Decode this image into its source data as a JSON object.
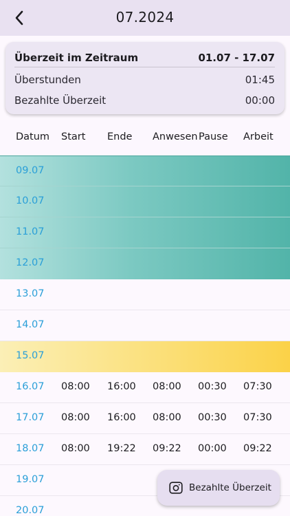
{
  "header": {
    "title": "07.2024",
    "back_icon": "back-arrow-icon"
  },
  "summary": {
    "title": "Überzeit im Zeitraum",
    "range": "01.07 - 17.07",
    "ueberstunden_label": "Überstunden",
    "ueberstunden_value": "01:45",
    "bezahlt_label": "Bezahlte Überzeit",
    "bezahlt_value": "00:00"
  },
  "table": {
    "columns": [
      "Datum",
      "Start",
      "Ende",
      "Anwesen",
      "Pause",
      "Arbeit"
    ],
    "rows": [
      {
        "date": "09.07",
        "start": "",
        "ende": "",
        "anwesend": "",
        "pause": "",
        "arbeit": ""
      },
      {
        "date": "10.07",
        "start": "",
        "ende": "",
        "anwesend": "",
        "pause": "",
        "arbeit": ""
      },
      {
        "date": "11.07",
        "start": "",
        "ende": "",
        "anwesend": "",
        "pause": "",
        "arbeit": ""
      },
      {
        "date": "12.07",
        "start": "",
        "ende": "",
        "anwesend": "",
        "pause": "",
        "arbeit": ""
      },
      {
        "date": "13.07",
        "start": "",
        "ende": "",
        "anwesend": "",
        "pause": "",
        "arbeit": ""
      },
      {
        "date": "14.07",
        "start": "",
        "ende": "",
        "anwesend": "",
        "pause": "",
        "arbeit": ""
      },
      {
        "date": "15.07",
        "start": "",
        "ende": "",
        "anwesend": "",
        "pause": "",
        "arbeit": ""
      },
      {
        "date": "16.07",
        "start": "08:00",
        "ende": "16:00",
        "anwesend": "08:00",
        "pause": "00:30",
        "arbeit": "07:30"
      },
      {
        "date": "17.07",
        "start": "08:00",
        "ende": "16:00",
        "anwesend": "08:00",
        "pause": "00:30",
        "arbeit": "07:30"
      },
      {
        "date": "18.07",
        "start": "08:00",
        "ende": "19:22",
        "anwesend": "09:22",
        "pause": "00:00",
        "arbeit": "09:22"
      },
      {
        "date": "19.07",
        "start": "",
        "ende": "",
        "anwesend": "",
        "pause": "",
        "arbeit": ""
      },
      {
        "date": "20.07",
        "start": "",
        "ende": "",
        "anwesend": "",
        "pause": "",
        "arbeit": ""
      }
    ]
  },
  "fab": {
    "label": "Bezahlte Überzeit",
    "icon": "camera-icon"
  },
  "colors": {
    "date_text": "#2a9fd8",
    "teal_highlight": "#52b4a9",
    "yellow_highlight": "#fbd248",
    "appbar_bg": "#e9e1f1"
  }
}
